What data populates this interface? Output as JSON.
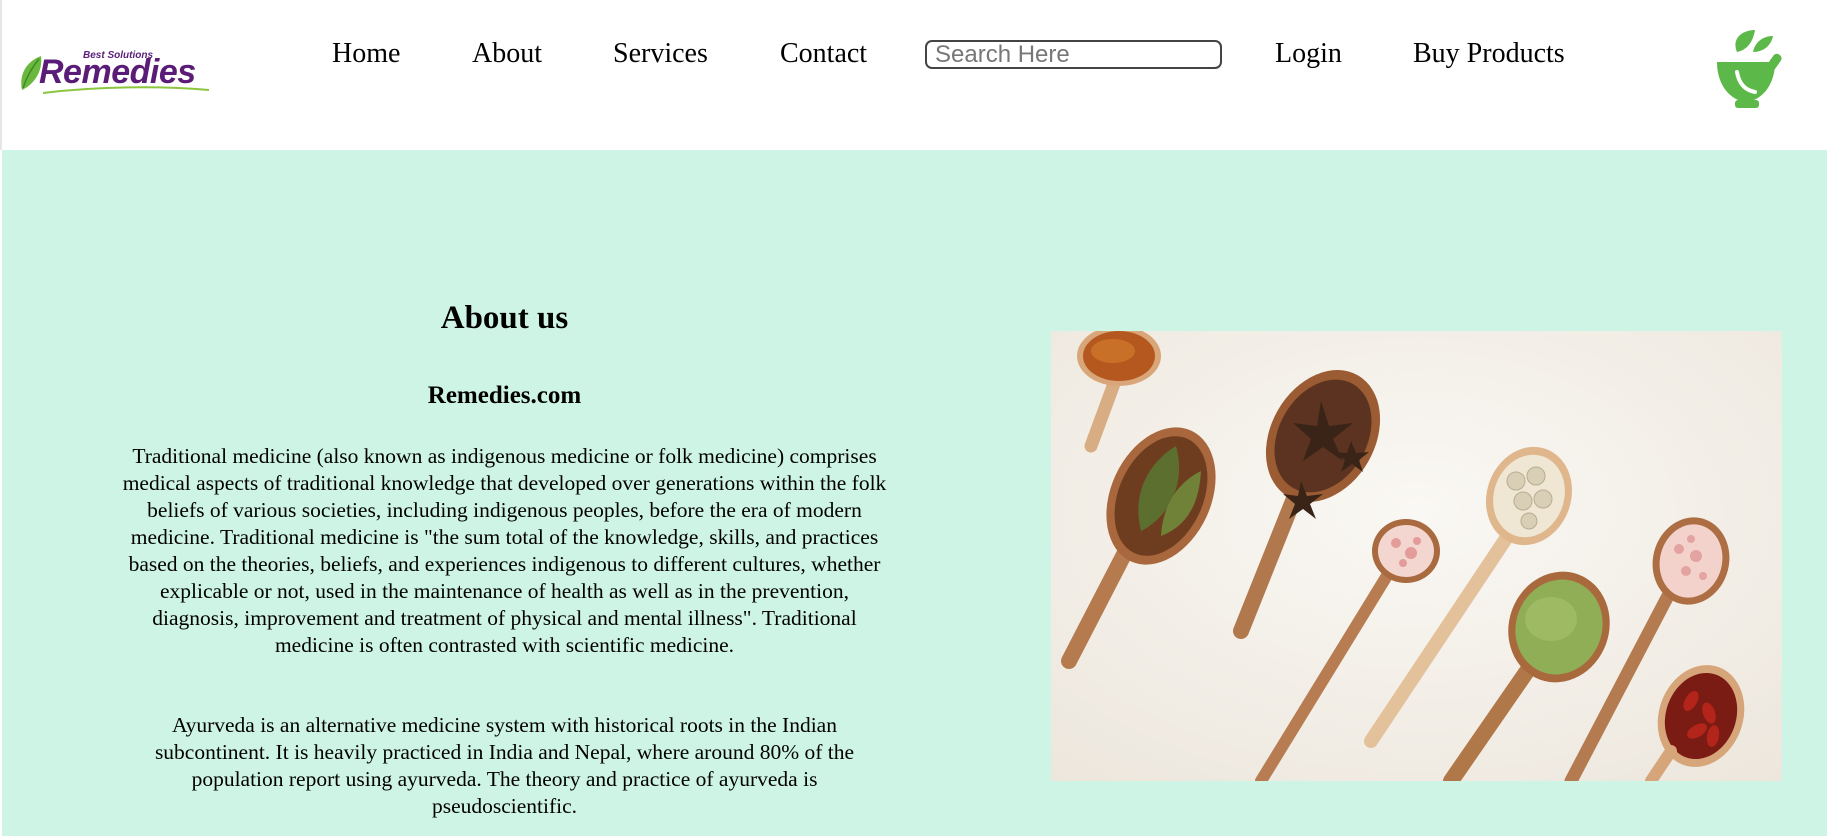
{
  "brand": {
    "tagline": "Best Solutions",
    "name": "Remedies",
    "logo_color": "#5b1c78",
    "leaf_color": "#6bb83f"
  },
  "nav": {
    "home": "Home",
    "about": "About",
    "services": "Services",
    "contact": "Contact",
    "search_placeholder": "Search Here",
    "login": "Login",
    "buy_products": "Buy Products"
  },
  "icons": {
    "header_right": "mortar-pestle-leaf-icon"
  },
  "about": {
    "title": "About us",
    "site": "Remedies.com",
    "paragraph1": "Traditional medicine (also known as indigenous medicine or folk medicine) comprises medical aspects of traditional knowledge that developed over generations within the folk beliefs of various societies, including indigenous peoples, before the era of modern medicine. Traditional medicine is \"the sum total of the knowledge, skills, and practices based on the theories, beliefs, and experiences indigenous to different cultures, whether explicable or not, used in the maintenance of health as well as in the prevention, diagnosis, improvement and treatment of physical and mental illness\". Traditional medicine is often contrasted with scientific medicine.",
    "paragraph2": "Ayurveda is an alternative medicine system with historical roots in the Indian subcontinent. It is heavily practiced in India and Nepal, where around 80% of the population report using ayurveda. The theory and practice of ayurveda is pseudoscientific."
  },
  "theme": {
    "main_background": "#cef4e5",
    "header_background": "#ffffff"
  }
}
